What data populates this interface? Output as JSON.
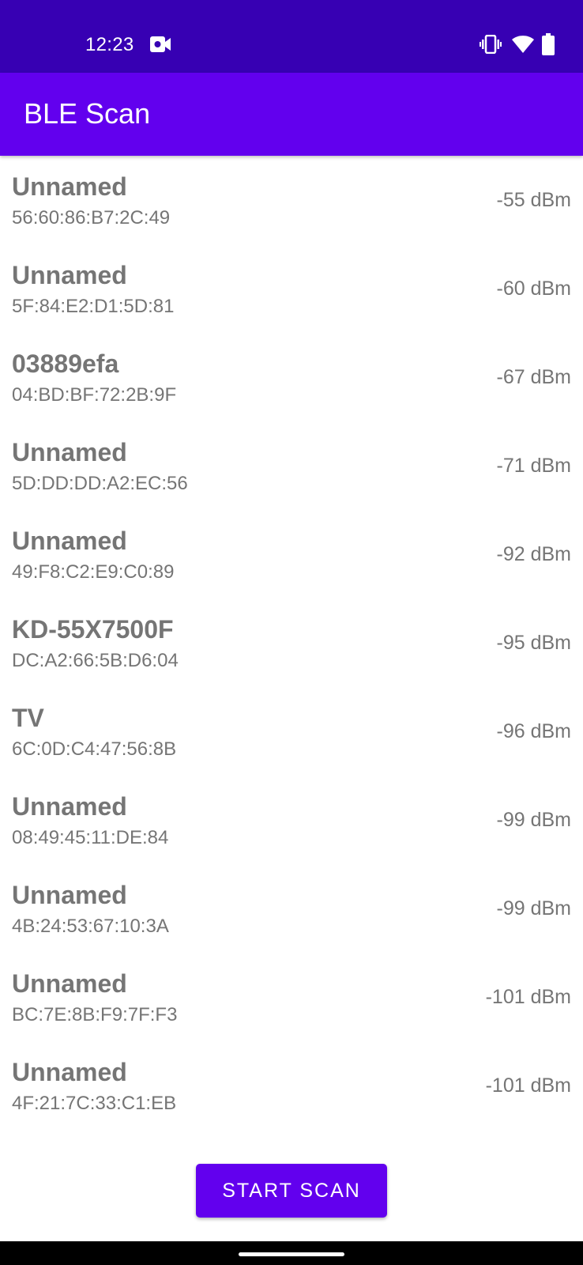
{
  "status_bar": {
    "time": "12:23",
    "icons": [
      "video-camera-icon",
      "vibrate-icon",
      "wifi-icon",
      "battery-icon"
    ],
    "background": "#3700b3"
  },
  "app_bar": {
    "title": "BLE Scan",
    "background": "#6200ee"
  },
  "devices": [
    {
      "name": "Unnamed",
      "address": "56:60:86:B7:2C:49",
      "rssi": "-55 dBm"
    },
    {
      "name": "Unnamed",
      "address": "5F:84:E2:D1:5D:81",
      "rssi": "-60 dBm"
    },
    {
      "name": "03889efa",
      "address": "04:BD:BF:72:2B:9F",
      "rssi": "-67 dBm"
    },
    {
      "name": "Unnamed",
      "address": "5D:DD:DD:A2:EC:56",
      "rssi": "-71 dBm"
    },
    {
      "name": "Unnamed",
      "address": "49:F8:C2:E9:C0:89",
      "rssi": "-92 dBm"
    },
    {
      "name": "KD-55X7500F",
      "address": "DC:A2:66:5B:D6:04",
      "rssi": "-95 dBm"
    },
    {
      "name": "TV",
      "address": "6C:0D:C4:47:56:8B",
      "rssi": "-96 dBm"
    },
    {
      "name": "Unnamed",
      "address": "08:49:45:11:DE:84",
      "rssi": "-99 dBm"
    },
    {
      "name": "Unnamed",
      "address": "4B:24:53:67:10:3A",
      "rssi": "-99 dBm"
    },
    {
      "name": "Unnamed",
      "address": "BC:7E:8B:F9:7F:F3",
      "rssi": "-101 dBm"
    },
    {
      "name": "Unnamed",
      "address": "4F:21:7C:33:C1:EB",
      "rssi": "-101 dBm"
    }
  ],
  "start_scan_button": {
    "label": "START SCAN",
    "background": "#6200ee"
  },
  "colors": {
    "text_secondary": "#757575",
    "nav_bar": "#000000"
  }
}
